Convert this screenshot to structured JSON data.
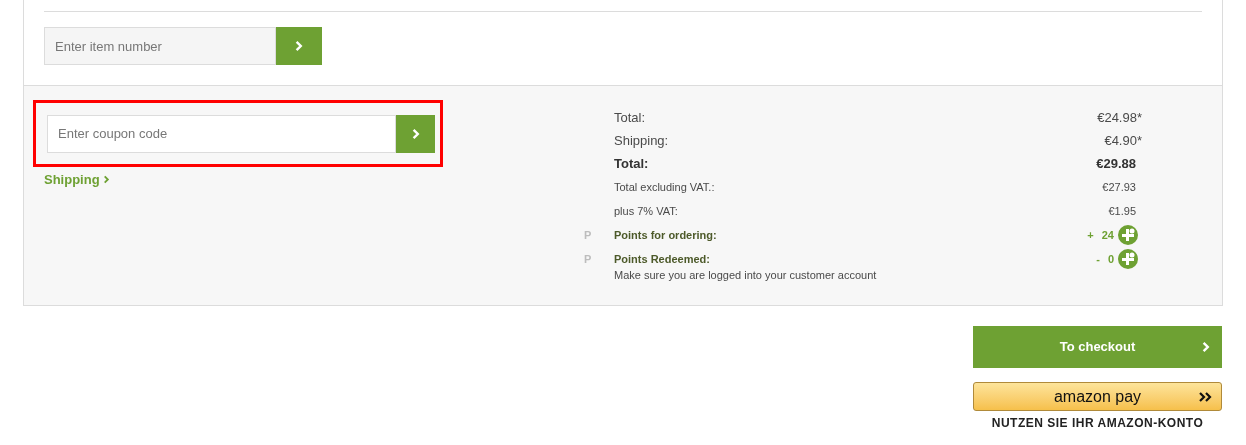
{
  "item_number": {
    "placeholder": "Enter item number"
  },
  "coupon": {
    "placeholder": "Enter coupon code",
    "highlighted": true
  },
  "shipping_link": "Shipping",
  "summary": [
    {
      "kind": "normal",
      "label": "Total:",
      "value": "€24.98*"
    },
    {
      "kind": "normal",
      "label": "Shipping:",
      "value": "€4.90*"
    },
    {
      "kind": "grand",
      "label": "Total:",
      "value": "€29.88"
    },
    {
      "kind": "small",
      "label": "Total excluding VAT.:",
      "value": "€27.93"
    },
    {
      "kind": "small",
      "label": "plus 7% VAT:",
      "value": "€1.95"
    },
    {
      "kind": "points",
      "marker": "P",
      "label": "Points for ordering:",
      "sign": "+",
      "value": "24"
    },
    {
      "kind": "points",
      "marker": "P",
      "label": "Points Redeemed:",
      "sign": "-",
      "value": "0"
    }
  ],
  "note": "Make sure you are logged into your customer account",
  "checkout_button": "To checkout",
  "amazon_pay": {
    "logo": "amazon pay",
    "caption": "NUTZEN SIE IHR AMAZON-KONTO"
  }
}
